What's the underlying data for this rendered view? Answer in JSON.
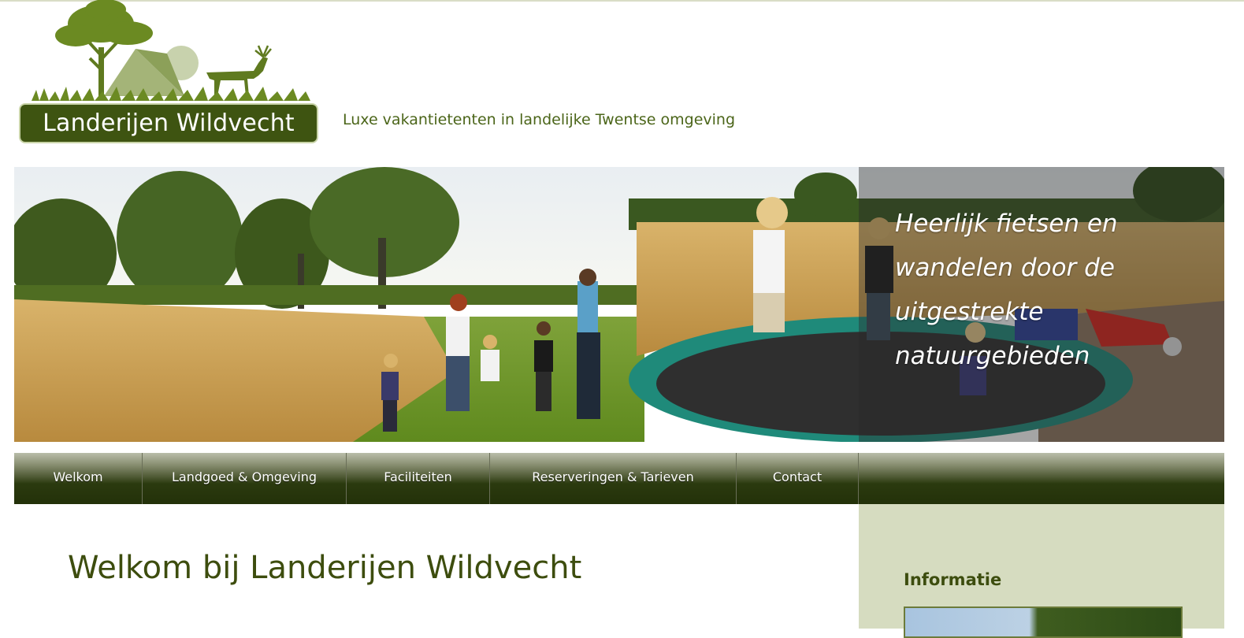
{
  "header": {
    "logo_text": "Landerijen Wildvecht",
    "tagline": "Luxe vakantietenten in landelijke Twentse omgeving"
  },
  "banner": {
    "caption_lines": [
      "Heerlijk fietsen en",
      "wandelen door de",
      "uitgestrekte",
      "natuurgebieden"
    ]
  },
  "nav": {
    "items": [
      {
        "label": "Welkom"
      },
      {
        "label": "Landgoed & Omgeving"
      },
      {
        "label": "Faciliteiten"
      },
      {
        "label": "Reserveringen & Tarieven"
      },
      {
        "label": "Contact"
      }
    ]
  },
  "main": {
    "heading": "Welkom bij Landerijen Wildvecht"
  },
  "sidebar": {
    "heading": "Informatie"
  },
  "colors": {
    "brand_green": "#3e5411",
    "heading_green": "#3d4d0e",
    "sidebar_bg": "#d6dcc0"
  }
}
